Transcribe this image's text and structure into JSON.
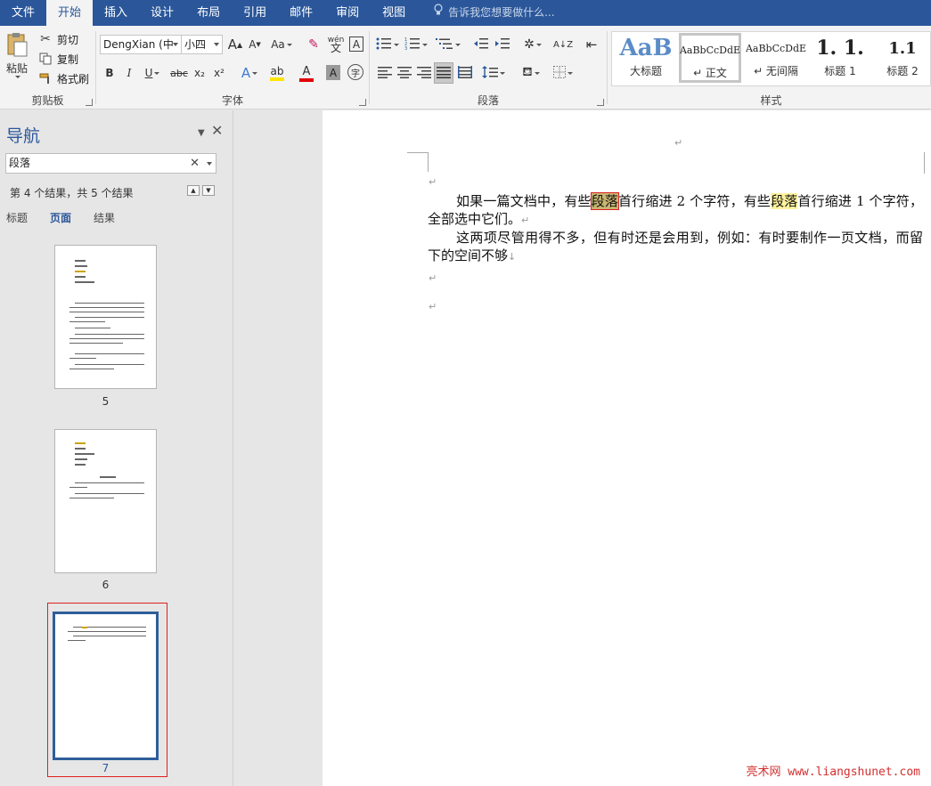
{
  "menubar": {
    "tabs": [
      "文件",
      "开始",
      "插入",
      "设计",
      "布局",
      "引用",
      "邮件",
      "审阅",
      "视图"
    ],
    "active_tab": "开始",
    "tell_me": "告诉我您想要做什么..."
  },
  "ribbon": {
    "clipboard": {
      "paste_label": "粘贴",
      "cut_label": "剪切",
      "copy_label": "复制",
      "format_painter_label": "格式刷",
      "group_label": "剪贴板"
    },
    "font": {
      "font_name": "DengXian (中",
      "font_size": "小四",
      "bold": "B",
      "italic": "I",
      "underline": "U",
      "strike": "abc",
      "subscript": "x₂",
      "superscript": "x²",
      "change_case": "Aa",
      "phonetic_top": "wén",
      "phonetic_bottom": "文",
      "char_border": "A",
      "grow": "A",
      "shrink": "A",
      "text_effect": "A",
      "font_color": "A",
      "char_shading": "A",
      "enclose": "字",
      "group_label": "字体"
    },
    "paragraph": {
      "group_label": "段落"
    },
    "styles": {
      "items": [
        {
          "preview": "AaB",
          "name": "大标题"
        },
        {
          "preview": "AaBbCcDdE",
          "name": "↵ 正文"
        },
        {
          "preview": "AaBbCcDdE",
          "name": "↵ 无间隔"
        },
        {
          "preview": "1. 1.",
          "name": "标题 1"
        },
        {
          "preview": "1.1",
          "name": "标题 2"
        }
      ],
      "group_label": "样式"
    }
  },
  "nav": {
    "title": "导航",
    "search_value": "段落",
    "result_count": "第 4 个结果，共 5 个结果",
    "tabs": [
      "标题",
      "页面",
      "结果"
    ],
    "active_tab": "页面",
    "pages": [
      "5",
      "6",
      "7"
    ]
  },
  "document": {
    "top_mark": "↵",
    "para1_pre": "如果一篇文档中，有些",
    "para1_hit1": "段落",
    "para1_mid": "首行缩进 2 个字符，有些",
    "para1_hit2": "段落",
    "para1_post": "首行缩进 1 个字符，全部选中它们。",
    "para2": "这两项尽管用得不多，但有时还是会用到，例如：有时要制作一页文档，而留下的空间不够",
    "empty_mark": "↵",
    "para_end_mark": "↵",
    "line_break_mark": "↓"
  },
  "watermark": "亮术网 www.liangshunet.com",
  "colors": {
    "accent": "#2b579a",
    "highlight": "#fff29e",
    "current_highlight": "#c8b570",
    "selection_red": "#d22222"
  }
}
